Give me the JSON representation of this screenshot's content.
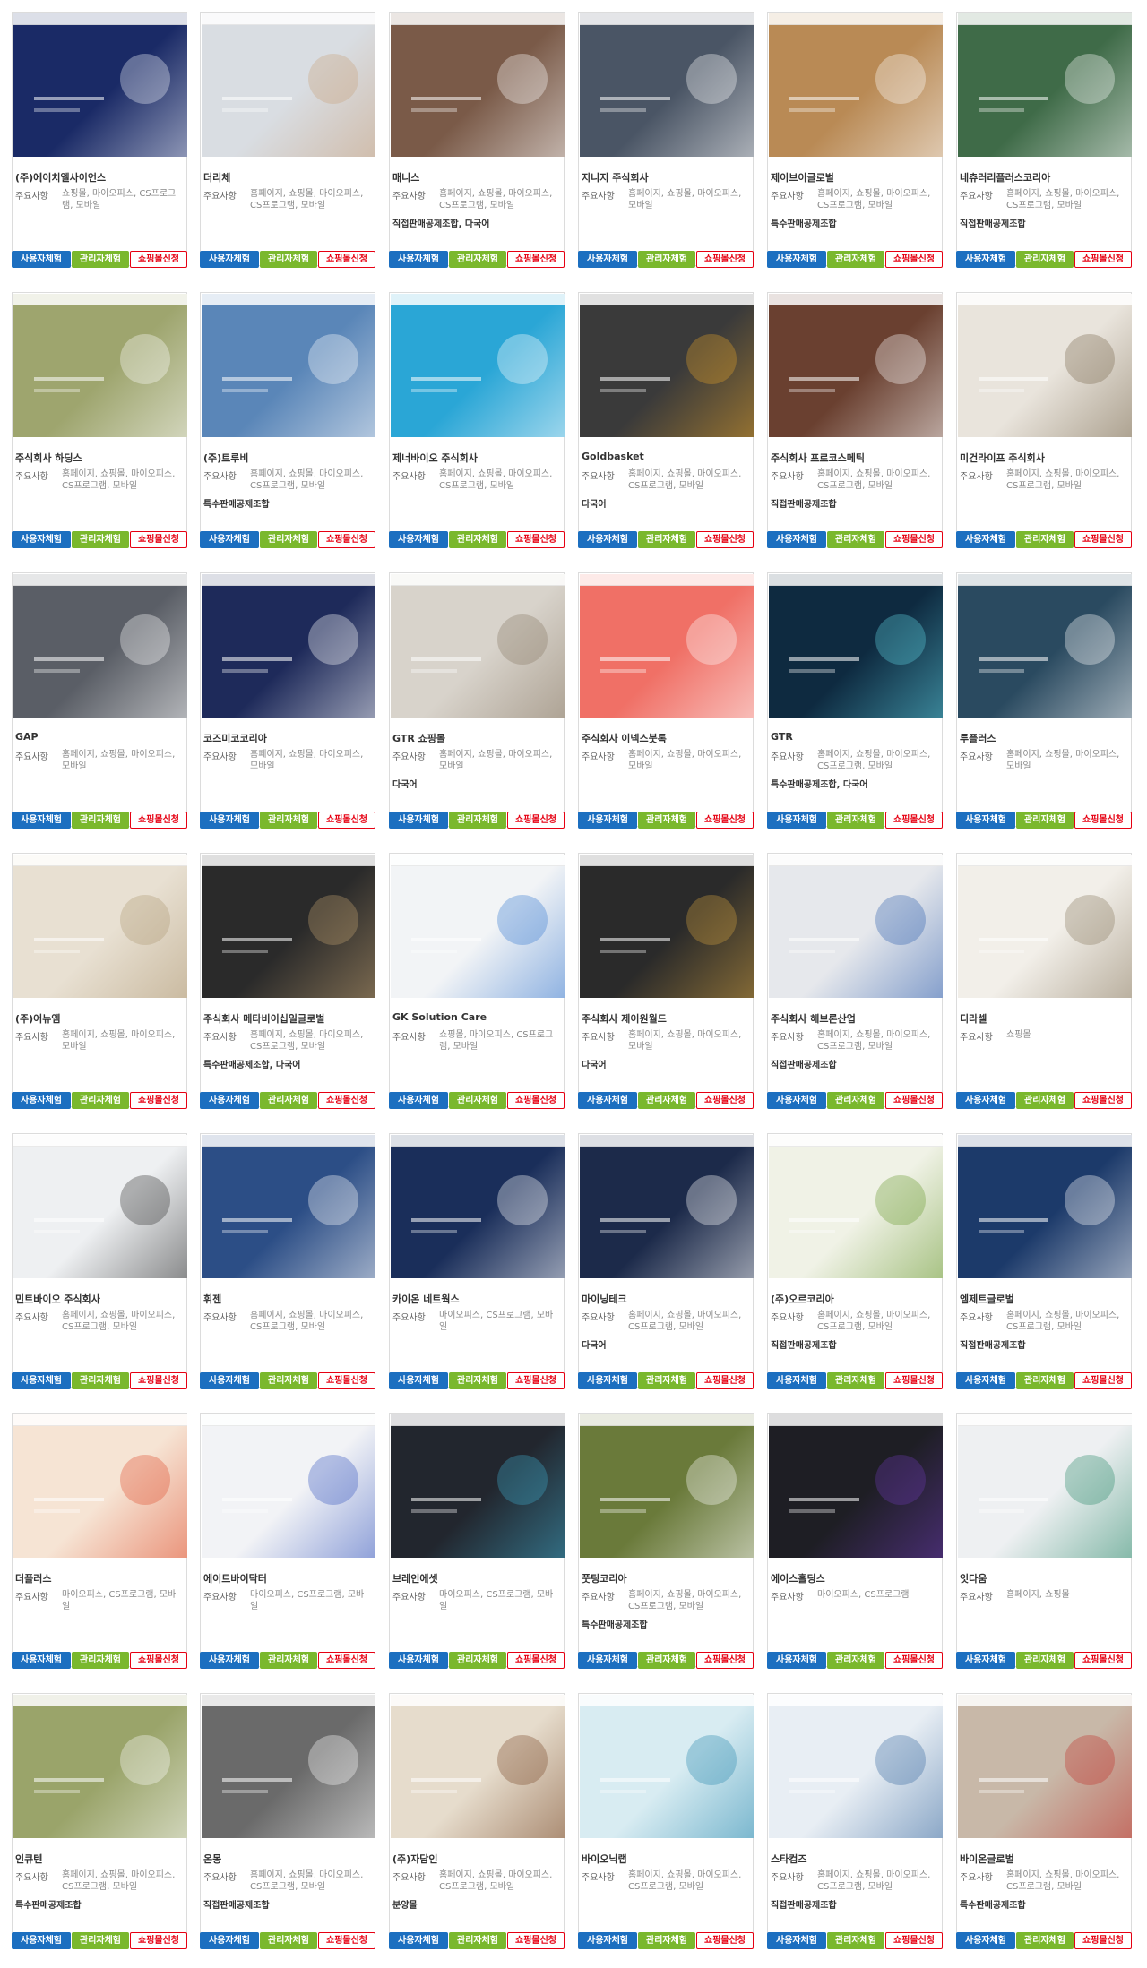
{
  "colors": {
    "user_button": "#1c6fc0",
    "admin_button": "#7ab82d",
    "shop_button_text": "#e60012",
    "border": "#dcdcdc"
  },
  "labels": {
    "main_items": "주요사항",
    "user_trial": "사용자체험",
    "admin_trial": "관리자체험",
    "shop_apply": "쇼핑몰신청"
  },
  "items": [
    {
      "name": "(주)에이치엘사이언스",
      "features": "쇼핑몰, 마이오피스, CS프로그램, 모바일",
      "extra": "",
      "thumb_color": "#1a2a66",
      "thumb_accent": "#f2f4fa"
    },
    {
      "name": "더리체",
      "features": "홈페이지, 쇼핑몰, 마이오피스, CS프로그램, 모바일",
      "extra": "",
      "thumb_color": "#d9dde2",
      "thumb_accent": "#c9a27e"
    },
    {
      "name": "매니스",
      "features": "홈페이지, 쇼핑몰, 마이오피스, CS프로그램, 모바일",
      "extra": "직접판매공제조합, 다국어",
      "thumb_color": "#7a5a48",
      "thumb_accent": "#ffffff"
    },
    {
      "name": "지니지 주식회사",
      "features": "홈페이지, 쇼핑몰, 마이오피스, 모바일",
      "extra": "",
      "thumb_color": "#4a5565",
      "thumb_accent": "#ffffff"
    },
    {
      "name": "제이브이글로벌",
      "features": "홈페이지, 쇼핑몰, 마이오피스, CS프로그램, 모바일",
      "extra": "특수판매공제조합",
      "thumb_color": "#b98a55",
      "thumb_accent": "#ffffff"
    },
    {
      "name": "네츄러리플러스코리아",
      "features": "홈페이지, 쇼핑몰, 마이오피스, CS프로그램, 모바일",
      "extra": "직접판매공제조합",
      "thumb_color": "#3f6b48",
      "thumb_accent": "#ffffff"
    },
    {
      "name": "주식회사 하딩스",
      "features": "홈페이지, 쇼핑몰, 마이오피스, CS프로그램, 모바일",
      "extra": "",
      "thumb_color": "#9ea56e",
      "thumb_accent": "#ffffff"
    },
    {
      "name": "(주)트루비",
      "features": "홈페이지, 쇼핑몰, 마이오피스, CS프로그램, 모바일",
      "extra": "특수판매공제조합",
      "thumb_color": "#5a86b8",
      "thumb_accent": "#ffffff"
    },
    {
      "name": "제너바이오 주식회사",
      "features": "홈페이지, 쇼핑몰, 마이오피스, CS프로그램, 모바일",
      "extra": "",
      "thumb_color": "#2aa6d6",
      "thumb_accent": "#ffffff"
    },
    {
      "name": "Goldbasket",
      "features": "홈페이지, 쇼핑몰, 마이오피스, CS프로그램, 모바일",
      "extra": "다국어",
      "thumb_color": "#3a3a3a",
      "thumb_accent": "#e0a02a"
    },
    {
      "name": "주식회사 프로코스메틱",
      "features": "홈페이지, 쇼핑몰, 마이오피스, CS프로그램, 모바일",
      "extra": "직접판매공제조합",
      "thumb_color": "#6a4030",
      "thumb_accent": "#ffffff"
    },
    {
      "name": "미건라이프 주식회사",
      "features": "홈페이지, 쇼핑몰, 마이오피스, CS프로그램, 모바일",
      "extra": "",
      "thumb_color": "#e9e4dc",
      "thumb_accent": "#7a6a50"
    },
    {
      "name": "GAP",
      "features": "홈페이지, 쇼핑몰, 마이오피스, 모바일",
      "extra": "",
      "thumb_color": "#5a5e66",
      "thumb_accent": "#ffffff"
    },
    {
      "name": "코즈미코코리아",
      "features": "홈페이지, 쇼핑몰, 마이오피스, 모바일",
      "extra": "",
      "thumb_color": "#1e2a5a",
      "thumb_accent": "#ffffff"
    },
    {
      "name": "GTR 쇼핑몰",
      "features": "홈페이지, 쇼핑몰, 마이오피스, 모바일",
      "extra": "다국어",
      "thumb_color": "#d8d3cb",
      "thumb_accent": "#8a7a66"
    },
    {
      "name": "주식회사 이넥스붓톡",
      "features": "홈페이지, 쇼핑몰, 마이오피스, 모바일",
      "extra": "",
      "thumb_color": "#f07066",
      "thumb_accent": "#ffffff"
    },
    {
      "name": "GTR",
      "features": "홈페이지, 쇼핑몰, 마이오피스, CS프로그램, 모바일",
      "extra": "특수판매공제조합, 다국어",
      "thumb_color": "#0e2a40",
      "thumb_accent": "#5fd0e0"
    },
    {
      "name": "투플러스",
      "features": "홈페이지, 쇼핑몰, 마이오피스, 모바일",
      "extra": "",
      "thumb_color": "#2a4a60",
      "thumb_accent": "#ffffff"
    },
    {
      "name": "(주)어뉴엠",
      "features": "홈페이지, 쇼핑몰, 마이오피스, 모바일",
      "extra": "",
      "thumb_color": "#e8e0d2",
      "thumb_accent": "#b09a76"
    },
    {
      "name": "주식회사 메타비이십일글로벌",
      "features": "홈페이지, 쇼핑몰, 마이오피스, CS프로그램, 모바일",
      "extra": "특수판매공제조합, 다국어",
      "thumb_color": "#2a2a2a",
      "thumb_accent": "#c0a070"
    },
    {
      "name": "GK Solution Care",
      "features": "쇼핑몰, 마이오피스, CS프로그램, 모바일",
      "extra": "",
      "thumb_color": "#f2f4f6",
      "thumb_accent": "#3a7ad0"
    },
    {
      "name": "주식회사 제이원월드",
      "features": "홈페이지, 쇼핑몰, 마이오피스, 모바일",
      "extra": "다국어",
      "thumb_color": "#2a2a2a",
      "thumb_accent": "#d0a040"
    },
    {
      "name": "주식회사 헤브론산업",
      "features": "홈페이지, 쇼핑몰, 마이오피스, CS프로그램, 모바일",
      "extra": "직접판매공제조합",
      "thumb_color": "#e6e8ec",
      "thumb_accent": "#3060b0"
    },
    {
      "name": "디라셀",
      "features": "쇼핑몰",
      "extra": "",
      "thumb_color": "#f2efe9",
      "thumb_accent": "#8a7a60"
    },
    {
      "name": "민트바이오 주식회사",
      "features": "홈페이지, 쇼핑몰, 마이오피스, CS프로그램, 모바일",
      "extra": "",
      "thumb_color": "#eef0f2",
      "thumb_accent": "#333333"
    },
    {
      "name": "휘젠",
      "features": "홈페이지, 쇼핑몰, 마이오피스, CS프로그램, 모바일",
      "extra": "",
      "thumb_color": "#2c4e86",
      "thumb_accent": "#ffffff"
    },
    {
      "name": "카이온 네트웍스",
      "features": "마이오피스, CS프로그램, 모바일",
      "extra": "",
      "thumb_color": "#1a2e5a",
      "thumb_accent": "#ffffff"
    },
    {
      "name": "마이닝테크",
      "features": "홈페이지, 쇼핑몰, 마이오피스, CS프로그램, 모바일",
      "extra": "다국어",
      "thumb_color": "#1c2a4a",
      "thumb_accent": "#ffffff"
    },
    {
      "name": "(주)오르코리아",
      "features": "홈페이지, 쇼핑몰, 마이오피스, CS프로그램, 모바일",
      "extra": "직접판매공제조합",
      "thumb_color": "#f0f2e6",
      "thumb_accent": "#6a9a30"
    },
    {
      "name": "엠제트글로벌",
      "features": "홈페이지, 쇼핑몰, 마이오피스, CS프로그램, 모바일",
      "extra": "직접판매공제조합",
      "thumb_color": "#1c3a6a",
      "thumb_accent": "#ffffff"
    },
    {
      "name": "더플러스",
      "features": "마이오피스, CS프로그램, 모바일",
      "extra": "",
      "thumb_color": "#f6e4d4",
      "thumb_accent": "#e05030"
    },
    {
      "name": "에이트바이닥터",
      "features": "마이오피스, CS프로그램, 모바일",
      "extra": "",
      "thumb_color": "#f2f3f6",
      "thumb_accent": "#3a5ac0"
    },
    {
      "name": "브레인에셋",
      "features": "마이오피스, CS프로그램, 모바일",
      "extra": "",
      "thumb_color": "#22262e",
      "thumb_accent": "#40a8c8"
    },
    {
      "name": "풋팅코리아",
      "features": "홈페이지, 쇼핑몰, 마이오피스, CS프로그램, 모바일",
      "extra": "특수판매공제조합",
      "thumb_color": "#6a7a3a",
      "thumb_accent": "#ffffff"
    },
    {
      "name": "에이스홀딩스",
      "features": "마이오피스, CS프로그램",
      "extra": "",
      "thumb_color": "#1e1e24",
      "thumb_accent": "#6a3ab0"
    },
    {
      "name": "잇다움",
      "features": "홈페이지, 쇼핑몰",
      "extra": "",
      "thumb_color": "#eef0f2",
      "thumb_accent": "#2a8a6a"
    },
    {
      "name": "인큐텐",
      "features": "홈페이지, 쇼핑몰, 마이오피스, CS프로그램, 모바일",
      "extra": "특수판매공제조합",
      "thumb_color": "#9aa46a",
      "thumb_accent": "#ffffff"
    },
    {
      "name": "온몽",
      "features": "홈페이지, 쇼핑몰, 마이오피스, CS프로그램, 모바일",
      "extra": "직접판매공제조합",
      "thumb_color": "#6a6a6a",
      "thumb_accent": "#ffffff"
    },
    {
      "name": "(주)자담인",
      "features": "홈페이지, 쇼핑몰, 마이오피스, CS프로그램, 모바일",
      "extra": "분양몰",
      "thumb_color": "#e6dccc",
      "thumb_accent": "#7a4a2a"
    },
    {
      "name": "바이오닉랩",
      "features": "홈페이지, 쇼핑몰, 마이오피스, CS프로그램, 모바일",
      "extra": "",
      "thumb_color": "#d8ecf2",
      "thumb_accent": "#2a8ab0"
    },
    {
      "name": "스타컴즈",
      "features": "홈페이지, 쇼핑몰, 마이오피스, CS프로그램, 모바일",
      "extra": "직접판매공제조합",
      "thumb_color": "#e8eef4",
      "thumb_accent": "#3a6aa0"
    },
    {
      "name": "바이온글로벌",
      "features": "홈페이지, 쇼핑몰, 마이오피스, CS프로그램, 모바일",
      "extra": "특수판매공제조합",
      "thumb_color": "#c8b8a8",
      "thumb_accent": "#c0302a"
    }
  ]
}
